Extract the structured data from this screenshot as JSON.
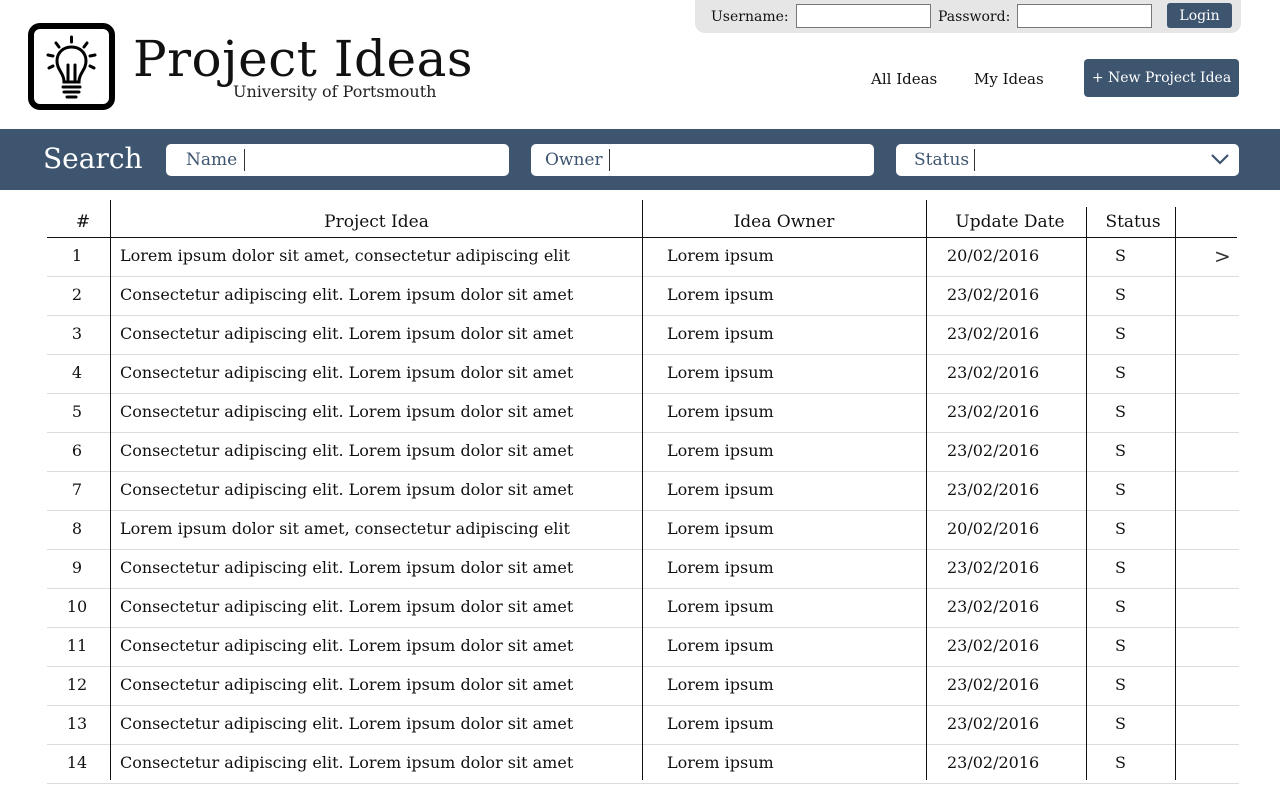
{
  "login": {
    "username_label": "Username:",
    "password_label": "Password:",
    "username_value": "",
    "password_value": "",
    "login_button": "Login"
  },
  "brand": {
    "title": "Project Ideas",
    "subtitle": "University of Portsmouth",
    "logo_icon": "lightbulb-icon"
  },
  "nav": {
    "all_ideas": "All Ideas",
    "my_ideas": "My Ideas",
    "new_idea_button": "+ New Project Idea"
  },
  "search": {
    "title": "Search",
    "name_placeholder": "Name",
    "owner_placeholder": "Owner",
    "status_placeholder": "Status",
    "status_icon": "chevron-down-icon"
  },
  "table": {
    "headers": [
      "#",
      "Project Idea",
      "Idea Owner",
      "Update Date",
      "Status"
    ],
    "rows": [
      {
        "num": "1",
        "idea": "Lorem ipsum dolor sit amet, consectetur adipiscing elit",
        "owner": "Lorem ipsum",
        "date": "20/02/2016",
        "status": "S",
        "arrow": ">"
      },
      {
        "num": "2",
        "idea": "Consectetur adipiscing elit. Lorem ipsum dolor sit amet",
        "owner": "Lorem ipsum",
        "date": "23/02/2016",
        "status": "S",
        "arrow": ""
      },
      {
        "num": "3",
        "idea": "Consectetur adipiscing elit. Lorem ipsum dolor sit amet",
        "owner": "Lorem ipsum",
        "date": "23/02/2016",
        "status": "S",
        "arrow": ""
      },
      {
        "num": "4",
        "idea": "Consectetur adipiscing elit. Lorem ipsum dolor sit amet",
        "owner": "Lorem ipsum",
        "date": "23/02/2016",
        "status": "S",
        "arrow": ""
      },
      {
        "num": "5",
        "idea": "Consectetur adipiscing elit. Lorem ipsum dolor sit amet",
        "owner": "Lorem ipsum",
        "date": "23/02/2016",
        "status": "S",
        "arrow": ""
      },
      {
        "num": "6",
        "idea": "Consectetur adipiscing elit. Lorem ipsum dolor sit amet",
        "owner": "Lorem ipsum",
        "date": "23/02/2016",
        "status": "S",
        "arrow": ""
      },
      {
        "num": "7",
        "idea": "Consectetur adipiscing elit. Lorem ipsum dolor sit amet",
        "owner": "Lorem ipsum",
        "date": "23/02/2016",
        "status": "S",
        "arrow": ""
      },
      {
        "num": "8",
        "idea": "Lorem ipsum dolor sit amet, consectetur adipiscing elit",
        "owner": "Lorem ipsum",
        "date": "20/02/2016",
        "status": "S",
        "arrow": ""
      },
      {
        "num": "9",
        "idea": "Consectetur adipiscing elit. Lorem ipsum dolor sit amet",
        "owner": "Lorem ipsum",
        "date": "23/02/2016",
        "status": "S",
        "arrow": ""
      },
      {
        "num": "10",
        "idea": "Consectetur adipiscing elit. Lorem ipsum dolor sit amet",
        "owner": "Lorem ipsum",
        "date": "23/02/2016",
        "status": "S",
        "arrow": ""
      },
      {
        "num": "11",
        "idea": "Consectetur adipiscing elit. Lorem ipsum dolor sit amet",
        "owner": "Lorem ipsum",
        "date": "23/02/2016",
        "status": "S",
        "arrow": ""
      },
      {
        "num": "12",
        "idea": "Consectetur adipiscing elit. Lorem ipsum dolor sit amet",
        "owner": "Lorem ipsum",
        "date": "23/02/2016",
        "status": "S",
        "arrow": ""
      },
      {
        "num": "13",
        "idea": "Consectetur adipiscing elit. Lorem ipsum dolor sit amet",
        "owner": "Lorem ipsum",
        "date": "23/02/2016",
        "status": "S",
        "arrow": ""
      },
      {
        "num": "14",
        "idea": "Consectetur adipiscing elit. Lorem ipsum dolor sit amet",
        "owner": "Lorem ipsum",
        "date": "23/02/2016",
        "status": "S",
        "arrow": ""
      }
    ]
  },
  "colors": {
    "accent": "#3e5570",
    "login_bg": "#e6e6e6",
    "text": "#111111"
  }
}
